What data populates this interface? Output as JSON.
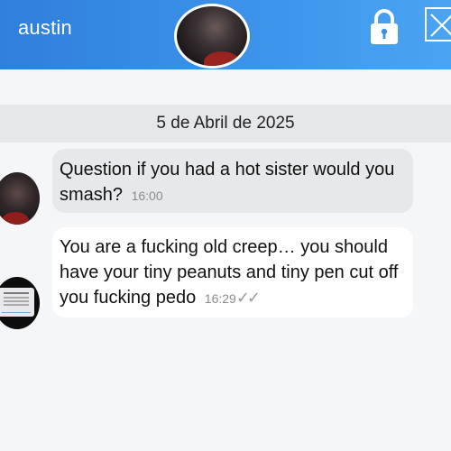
{
  "header": {
    "contact_name": "austin",
    "lock_icon": "lock-icon",
    "close_icon": "close-icon",
    "gradient_start": "#2f7fdc",
    "gradient_end": "#4ba4f2"
  },
  "date_separator": "5 de Abril de 2025",
  "messages": [
    {
      "direction": "incoming",
      "text": "Question if you had a hot sister would you smash?",
      "time": "16:00"
    },
    {
      "direction": "outgoing",
      "text": "You are a fucking old creep… you should have your tiny peanuts and tiny pen cut off you fucking pedo",
      "time": "16:29",
      "status": "✓✓"
    }
  ]
}
